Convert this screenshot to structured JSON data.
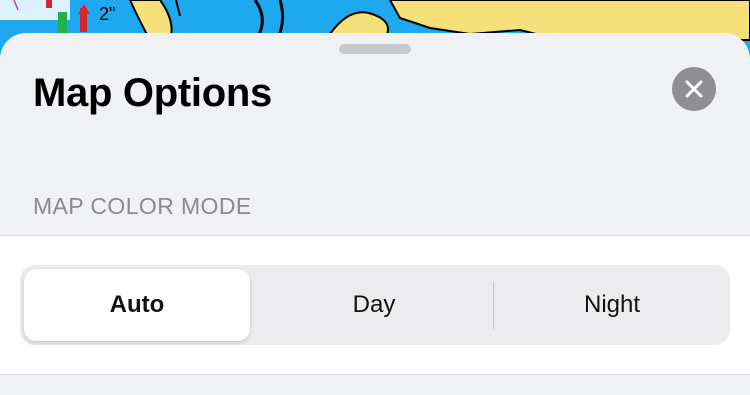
{
  "sheet": {
    "title": "Map Options",
    "close_icon": "close-icon"
  },
  "map_color_mode": {
    "header": "MAP COLOR MODE",
    "options": [
      {
        "label": "Auto",
        "selected": true
      },
      {
        "label": "Day",
        "selected": false
      },
      {
        "label": "Night",
        "selected": false
      }
    ]
  },
  "map_background": {
    "label": "2\"",
    "colors": {
      "water": "#1ea8f0",
      "land": "#f5e07a",
      "coast": "#000000"
    }
  }
}
